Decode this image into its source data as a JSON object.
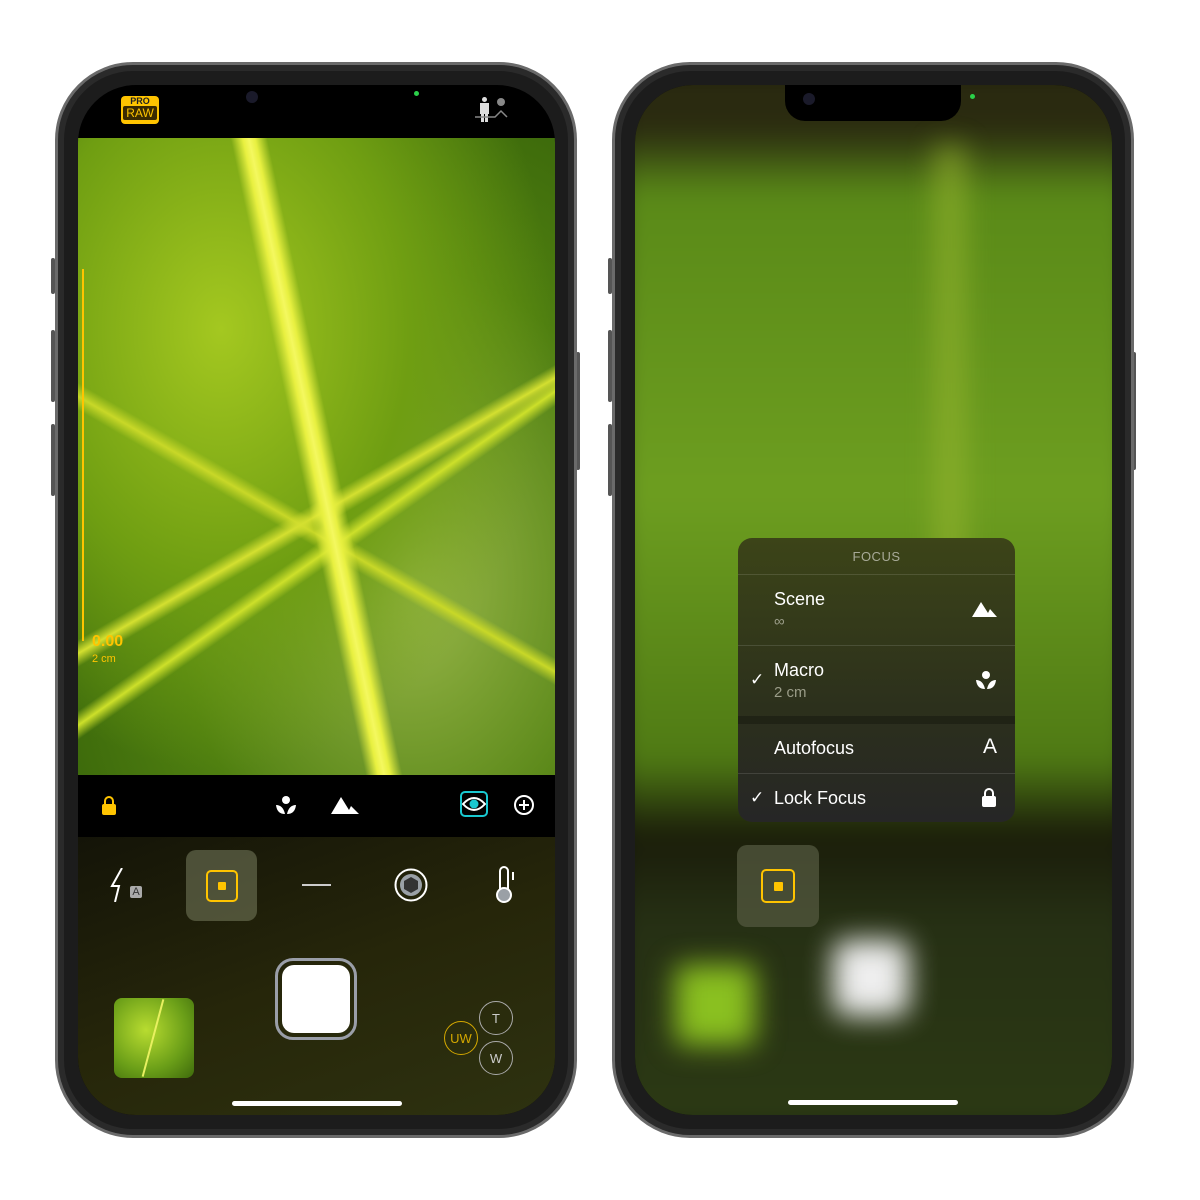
{
  "left_phone": {
    "top_bar": {
      "pro_label": "PRO",
      "raw_label": "RAW",
      "person_icon": "portrait-depth-icon"
    },
    "focus_readout": {
      "value": "0.00",
      "distance": "2 cm"
    },
    "toolbar": {
      "icons": [
        "lock-icon",
        "macro-icon",
        "scene-icon",
        "focus-peaking-icon",
        "add-icon"
      ]
    },
    "controls": {
      "flash_badge": "A",
      "icons": [
        "flash-auto-icon",
        "focus-mode-icon",
        "exposure-icon",
        "shutter-speed-icon",
        "white-balance-icon"
      ]
    },
    "lenses": {
      "uw": "UW",
      "t": "T",
      "w": "W",
      "active": "UW"
    }
  },
  "right_phone": {
    "focus_menu": {
      "title": "FOCUS",
      "items": [
        {
          "label": "Scene",
          "sub": "∞",
          "icon": "scene-icon",
          "checked": false
        },
        {
          "label": "Macro",
          "sub": "2 cm",
          "icon": "macro-icon",
          "checked": true
        },
        {
          "label": "Autofocus",
          "icon": "autofocus-icon",
          "icon_text": "A",
          "checked": false
        },
        {
          "label": "Lock Focus",
          "icon": "lock-icon",
          "checked": true
        }
      ],
      "check": "✓"
    }
  },
  "colors": {
    "accent": "#ffc400",
    "peaking": "#19c8d0"
  }
}
